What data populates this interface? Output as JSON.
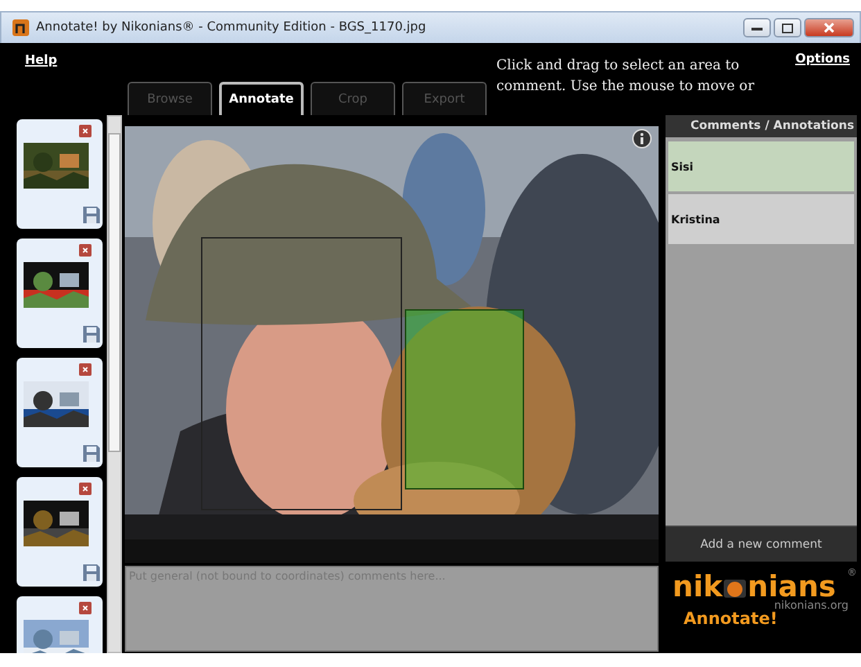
{
  "window": {
    "title": "Annotate! by Nikonians® - Community Edition - BGS_1170.jpg"
  },
  "menu": {
    "help": "Help",
    "options": "Options"
  },
  "instructions": "Click and drag to select an area to comment. Use the mouse to move or",
  "tabs": [
    {
      "label": "Browse",
      "selected": false
    },
    {
      "label": "Annotate",
      "selected": true
    },
    {
      "label": "Crop",
      "selected": false
    },
    {
      "label": "Export",
      "selected": false
    }
  ],
  "annotations": [
    {
      "name": "Sisi",
      "selected": true
    },
    {
      "name": "Kristina",
      "selected": false
    }
  ],
  "comments_header": "Comments / Annotations",
  "add_comment": "Add a new comment",
  "general_comments": {
    "placeholder": "Put general (not bound to coordinates) comments here..."
  },
  "logo": {
    "brand_start": "nik",
    "brand_end": "nians",
    "site": "nikonians.org",
    "product": "Annotate!",
    "mark": "®"
  }
}
